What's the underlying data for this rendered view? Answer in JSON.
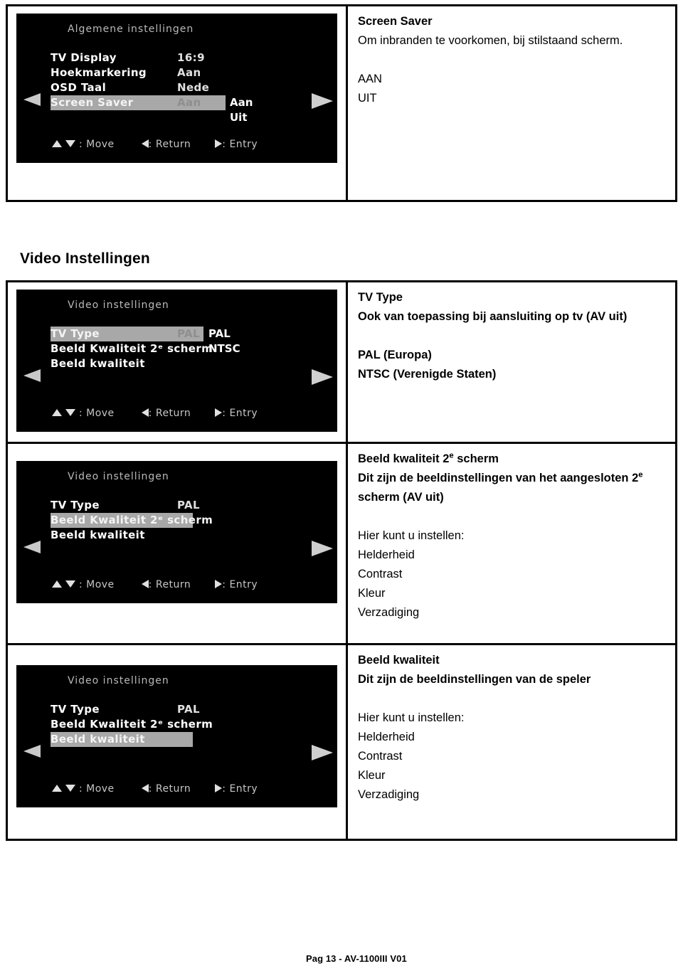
{
  "page": {
    "footer": "Pag 13 - AV-1100III V01"
  },
  "section_heading": "Video Instellingen",
  "table_general": {
    "row": {
      "osd": {
        "title": "Algemene instellingen",
        "items": [
          {
            "label": "TV  Display",
            "value": "16:9",
            "highlighted": false
          },
          {
            "label": "Hoekmarkering",
            "value": "Aan",
            "highlighted": false
          },
          {
            "label": "OSD  Taal",
            "value": "Nede",
            "highlighted": false
          },
          {
            "label": "Screen  Saver",
            "value": "Aan",
            "highlighted": true
          }
        ],
        "submenu": [
          "Aan",
          "Uit"
        ],
        "hints": {
          "move": ": Move",
          "return": ": Return",
          "entry": ": Entry"
        }
      },
      "desc": {
        "title": "Screen Saver",
        "body": "Om inbranden te voorkomen, bij stilstaand scherm.",
        "options": [
          "AAN",
          "UIT"
        ]
      }
    }
  },
  "table_video": {
    "rows": [
      {
        "osd": {
          "title": "Video instellingen",
          "items": [
            {
              "label": "TV  Type",
              "value": "PAL",
              "highlighted": true
            },
            {
              "label": "Beeld Kwaliteit 2ᵉ scherm",
              "value": "",
              "highlighted": false
            },
            {
              "label": "Beeld  kwaliteit",
              "value": "",
              "highlighted": false
            }
          ],
          "submenu": [
            "PAL",
            "NTSC"
          ],
          "hints": {
            "move": ": Move",
            "return": ": Return",
            "entry": ": Entry"
          }
        },
        "desc": {
          "title": "TV Type",
          "body_bold": "Ook van toepassing bij aansluiting op tv (AV uit)",
          "options": [
            "PAL (Europa)",
            "NTSC (Verenigde Staten)"
          ]
        }
      },
      {
        "osd": {
          "title": "Video instellingen",
          "items": [
            {
              "label": "TV  Type",
              "value": "PAL",
              "highlighted": false
            },
            {
              "label": "Beeld Kwaliteit 2ᵉ scherm",
              "value": "",
              "highlighted": true
            },
            {
              "label": "Beeld  kwaliteit",
              "value": "",
              "highlighted": false
            }
          ],
          "submenu": [],
          "hints": {
            "move": ": Move",
            "return": ": Return",
            "entry": ": Entry"
          }
        },
        "desc": {
          "title_pre": "Beeld kwaliteit 2",
          "title_sup": "e",
          "title_post": " scherm",
          "body_pre": "Dit zijn de beeldinstellingen van het aangesloten 2",
          "body_sup": "e",
          "body_post": " scherm (AV uit)",
          "intro": "Hier kunt u instellen:",
          "settings": [
            "Helderheid",
            "Contrast",
            "Kleur",
            "Verzadiging"
          ]
        }
      },
      {
        "osd": {
          "title": "Video instellingen",
          "items": [
            {
              "label": "TV  Type",
              "value": "PAL",
              "highlighted": false
            },
            {
              "label": "Beeld Kwaliteit 2ᵉ scherm",
              "value": "",
              "highlighted": false
            },
            {
              "label": "Beeld  kwaliteit",
              "value": "",
              "highlighted": true
            }
          ],
          "submenu": [],
          "hints": {
            "move": ": Move",
            "return": ": Return",
            "entry": ": Entry"
          }
        },
        "desc": {
          "title": "Beeld kwaliteit",
          "body_bold": "Dit zijn de beeldinstellingen van de speler",
          "intro": "Hier kunt u instellen:",
          "settings": [
            "Helderheid",
            "Contrast",
            "Kleur",
            "Verzadiging"
          ]
        }
      }
    ]
  }
}
